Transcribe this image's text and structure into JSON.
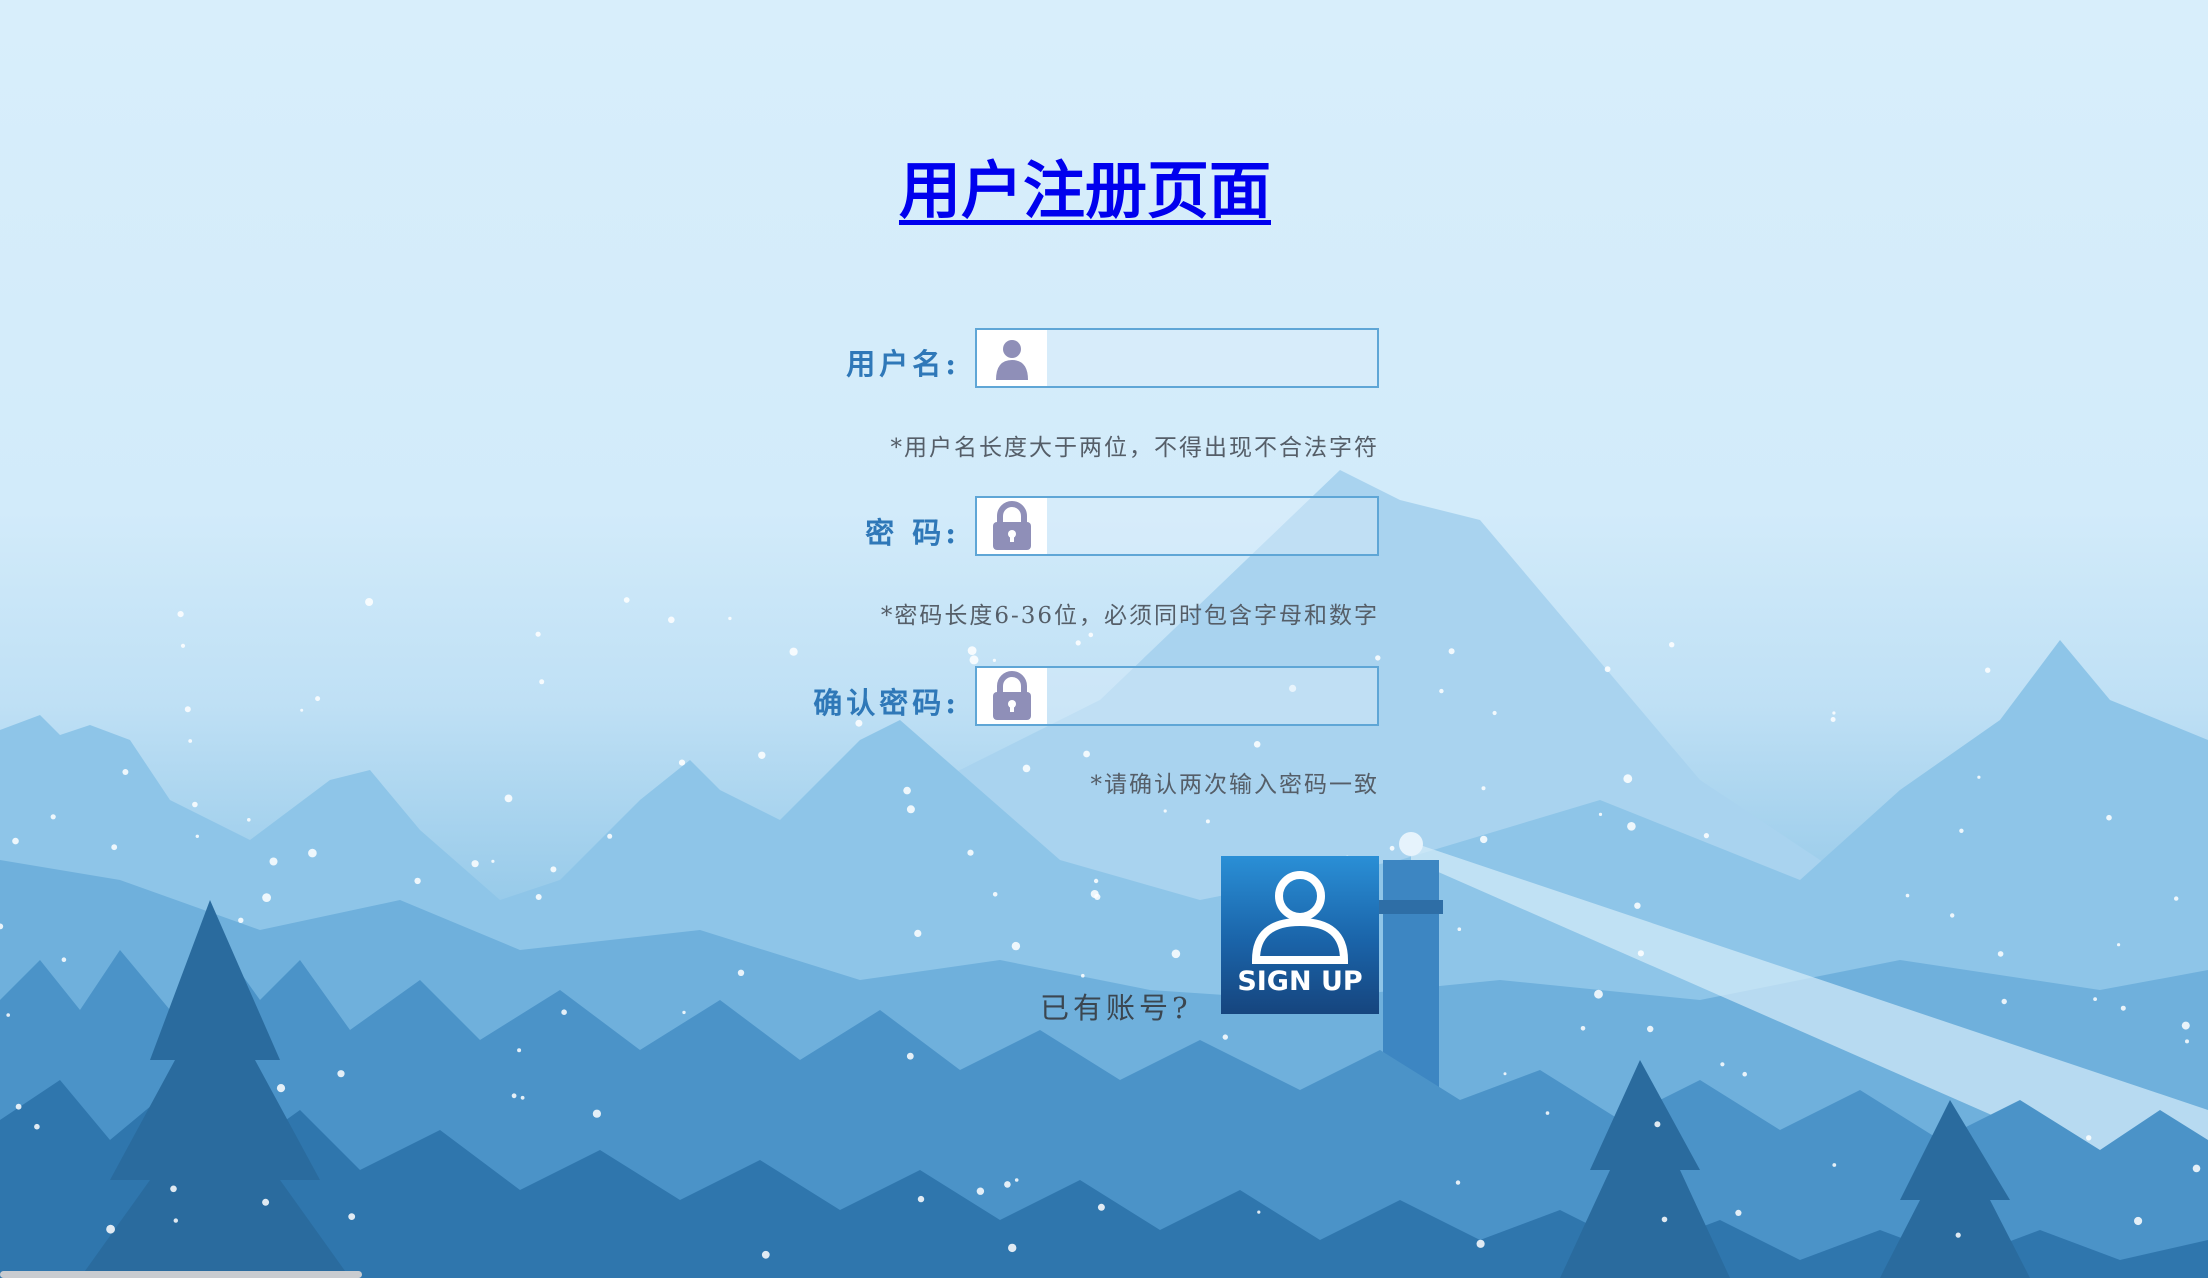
{
  "page": {
    "title": "用户注册页面"
  },
  "form": {
    "username": {
      "label": "用户名:",
      "icon": "user-icon",
      "value": "",
      "hint": "*用户名长度大于两位，不得出现不合法字符"
    },
    "password": {
      "label": "密 码:",
      "icon": "lock-icon",
      "value": "",
      "hint": "*密码长度6-36位，必须同时包含字母和数字"
    },
    "confirm": {
      "label": "确认密码:",
      "icon": "lock-icon",
      "value": "",
      "hint": "*请确认两次输入密码一致"
    }
  },
  "footer": {
    "have_account": "已有账号?",
    "signup_label": "SIGN UP",
    "signup_icon": "person-icon"
  },
  "colors": {
    "title": "#0000ee",
    "label": "#2f78b8",
    "field_border": "#5fa6d6",
    "signup_bg": "#1a63a8"
  }
}
